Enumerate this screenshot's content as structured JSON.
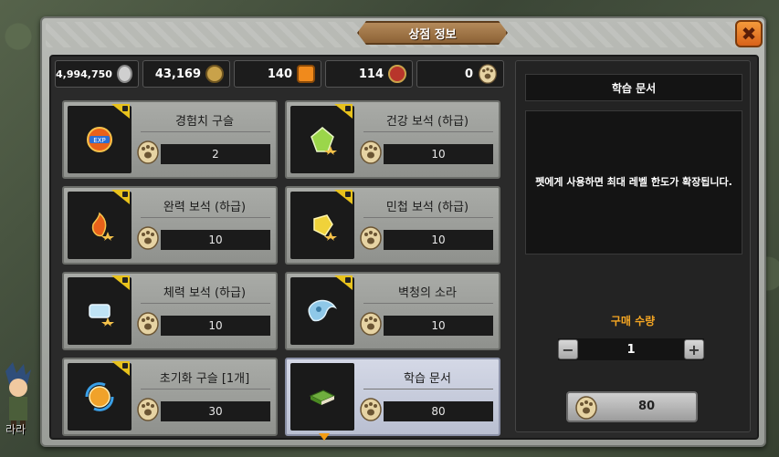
{
  "window": {
    "title": "상점 정보",
    "close_icon": "close-icon"
  },
  "background": {
    "character_name": "라라"
  },
  "currencies": [
    {
      "value": "4,994,750",
      "icon": "silver-coin-icon",
      "color": "#cfcfcf"
    },
    {
      "value": "43,169",
      "icon": "compass-coin-icon",
      "color": "#c9a24a"
    },
    {
      "value": "140",
      "icon": "orange-gem-icon",
      "color": "#f08a1c"
    },
    {
      "value": "114",
      "icon": "red-medal-icon",
      "color": "#b8352b"
    },
    {
      "value": "0",
      "icon": "paw-coin-icon",
      "color": "#e6d3a3"
    }
  ],
  "items": [
    {
      "name": "경험치 구슬",
      "price": "2",
      "icon": "exp-orb-icon",
      "locked": true
    },
    {
      "name": "건강 보석 (하급)",
      "price": "10",
      "icon": "green-gem-icon",
      "locked": true
    },
    {
      "name": "완력 보석 (하급)",
      "price": "10",
      "icon": "red-gem-icon",
      "locked": true
    },
    {
      "name": "민첩 보석 (하급)",
      "price": "10",
      "icon": "yellow-gem-icon",
      "locked": true
    },
    {
      "name": "체력 보석 (하급)",
      "price": "10",
      "icon": "blue-gem-icon",
      "locked": true
    },
    {
      "name": "벽청의 소라",
      "price": "10",
      "icon": "conch-shell-icon",
      "locked": true
    },
    {
      "name": "초기화 구슬 [1개]",
      "price": "30",
      "icon": "reset-orb-icon",
      "locked": true
    },
    {
      "name": "학습 문서",
      "price": "80",
      "icon": "book-icon",
      "locked": false,
      "selected": true
    }
  ],
  "detail": {
    "title": "학습 문서",
    "description": "펫에게 사용하면 최대 레벨 한도가 확장됩니다.",
    "quantity_label": "구매 수량",
    "quantity": "1",
    "minus_label": "−",
    "plus_label": "+",
    "buy_price": "80"
  }
}
